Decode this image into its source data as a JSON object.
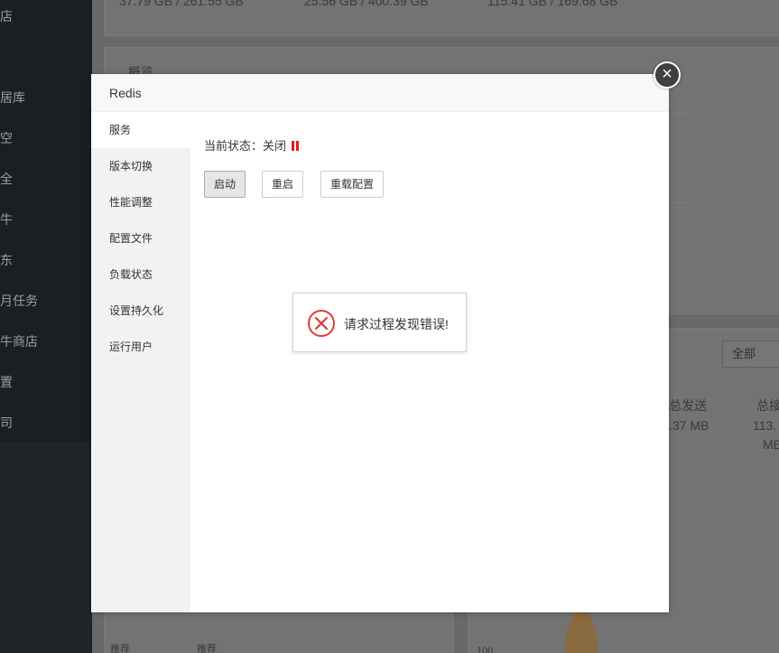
{
  "background": {
    "sidebar_items": [
      "店",
      "居库",
      "空",
      "全",
      "牛",
      "东",
      "月任务",
      "牛商店",
      "置",
      "司"
    ],
    "disk_stats": [
      "37.79 GB / 261.55 GB",
      "25.56 GB / 400.39 GB",
      "115.41 GB / 169.68 GB"
    ],
    "overview_title": "概览",
    "network_select": "全部",
    "total_sent_label": "总发送",
    "total_sent_value": ".37 MB",
    "total_recv_label": "总接",
    "total_recv_value_1": "113.",
    "total_recv_value_2": "ME",
    "tag_1": "推荐",
    "tag_2": "推荐",
    "axis_value": "100"
  },
  "modal": {
    "title": "Redis",
    "close_glyph": "×",
    "tabs": [
      {
        "label": "服务",
        "active": true
      },
      {
        "label": "版本切换",
        "active": false
      },
      {
        "label": "性能调整",
        "active": false
      },
      {
        "label": "配置文件",
        "active": false
      },
      {
        "label": "负载状态",
        "active": false
      },
      {
        "label": "设置持久化",
        "active": false
      },
      {
        "label": "运行用户",
        "active": false
      }
    ],
    "status_label": "当前状态：",
    "status_value": "关闭",
    "status_color": "#e6161c",
    "buttons": {
      "start": "启动",
      "restart": "重启",
      "reload": "重载配置"
    }
  },
  "toast": {
    "message": "请求过程发现错误!",
    "icon": "error-circle-icon",
    "icon_color": "#e53935"
  }
}
